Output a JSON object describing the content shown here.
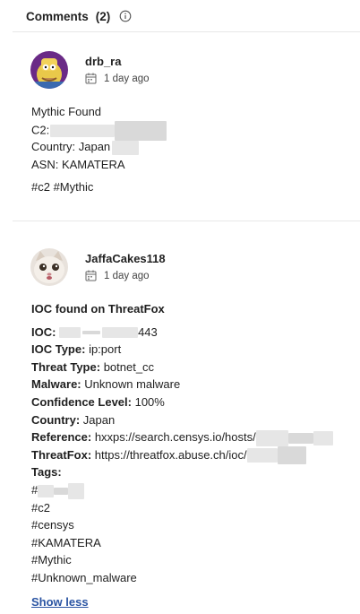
{
  "header": {
    "title": "Comments",
    "count": "(2)",
    "info_icon": "info-icon"
  },
  "comments": [
    {
      "username": "drb_ra",
      "date": "1 day ago",
      "lines": [
        {
          "text": "Mythic Found"
        },
        {
          "label": "C2:"
        },
        {
          "text": "Country: Japan"
        },
        {
          "text": "ASN: KAMATERA"
        }
      ],
      "tags_line": "#c2 #Mythic"
    },
    {
      "username": "JaffaCakes118",
      "date": "1 day ago",
      "heading": "IOC found on ThreatFox",
      "fields": [
        {
          "label": "IOC:",
          "value": "443"
        },
        {
          "label": "IOC Type:",
          "value": "ip:port"
        },
        {
          "label": "Threat Type:",
          "value": "botnet_cc"
        },
        {
          "label": "Malware:",
          "value": "Unknown malware"
        },
        {
          "label": "Confidence Level:",
          "value": "100%"
        },
        {
          "label": "Country:",
          "value": "Japan"
        },
        {
          "label": "Reference:",
          "value": "hxxps://search.censys.io/hosts/"
        },
        {
          "label": "ThreatFox:",
          "value": "https://threatfox.abuse.ch/ioc/"
        },
        {
          "label": "Tags:",
          "value": ""
        }
      ],
      "tags": [
        "#",
        "#c2",
        "#censys",
        "#KAMATERA",
        "#Mythic",
        "#Unknown_malware"
      ]
    }
  ],
  "show_less": "Show less"
}
